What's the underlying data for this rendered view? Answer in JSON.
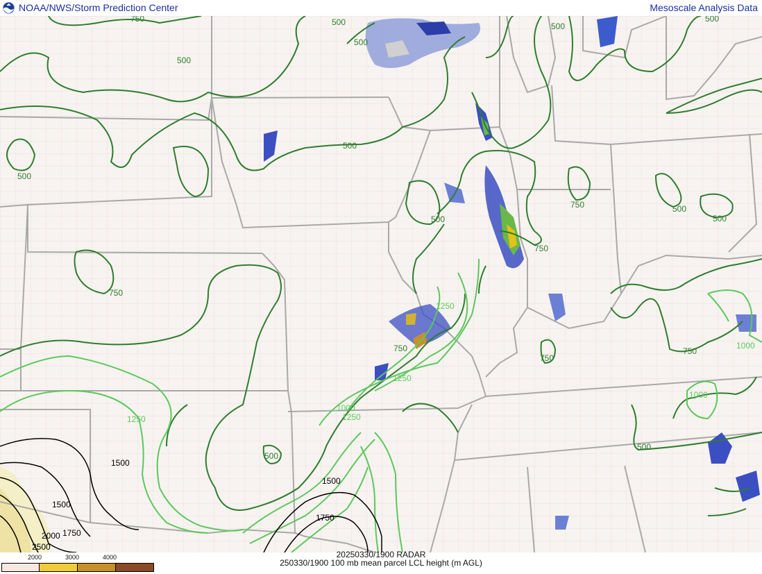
{
  "header": {
    "left_title": "NOAA/NWS/Storm Prediction Center",
    "right_title": "Mesoscale Analysis Data",
    "logo_icon": "noaa-logo-icon"
  },
  "footer": {
    "line1": "20250330/1900 RADAR",
    "line2": "250330/1900 100 mb mean parcel LCL height (m AGL)"
  },
  "legend": {
    "labels": [
      "2000",
      "3000",
      "4000"
    ],
    "colors": [
      "#f9e8e0",
      "#f2cc37",
      "#c98f2a",
      "#8b4a25"
    ]
  },
  "contour_labels": [
    "750",
    "500",
    "500",
    "500",
    "500",
    "500",
    "500",
    "500",
    "500",
    "500",
    "500",
    "750",
    "750",
    "750",
    "750",
    "750",
    "750",
    "1250",
    "1250",
    "1250",
    "1250",
    "1000",
    "1000",
    "1000",
    "1500",
    "1500",
    "1500",
    "1750",
    "1750",
    "2000",
    "2500",
    "500",
    "500"
  ],
  "colors": {
    "background": "#f7f3f0",
    "contour_500_750": "#2e7d2e",
    "contour_1000_1250": "#5cc85c",
    "contour_1500_plus": "#000000",
    "borders": "#a9a9a9",
    "title_text": "#1a2fa0"
  }
}
